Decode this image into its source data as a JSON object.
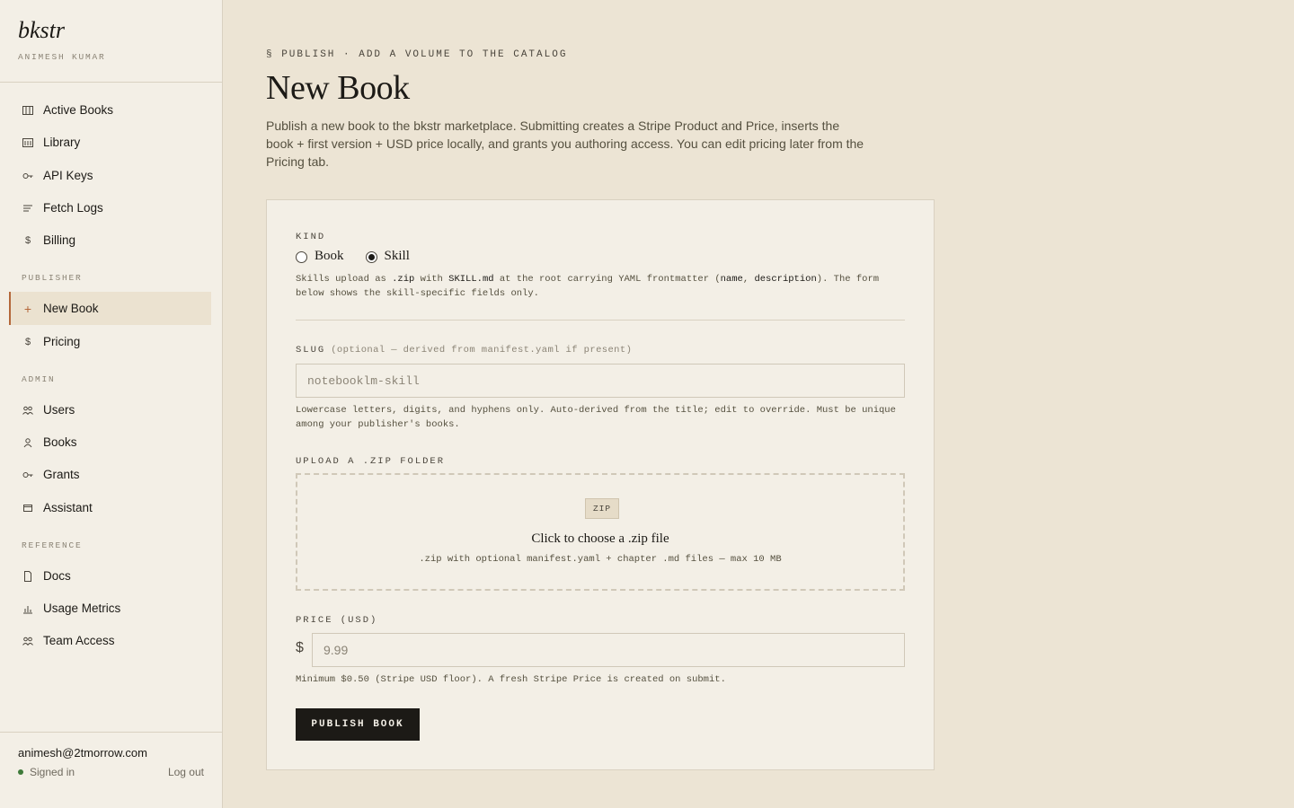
{
  "brand": {
    "name": "bkstr",
    "user": "ANIMESH KUMAR"
  },
  "nav": {
    "main": [
      {
        "label": "Active Books",
        "icon": "columns-icon"
      },
      {
        "label": "Library",
        "icon": "library-icon"
      },
      {
        "label": "API Keys",
        "icon": "key-icon"
      },
      {
        "label": "Fetch Logs",
        "icon": "lines-icon"
      },
      {
        "label": "Billing",
        "icon": "dollar-icon"
      }
    ],
    "publisher_label": "PUBLISHER",
    "publisher": [
      {
        "label": "New Book",
        "icon": "plus-icon",
        "active": true
      },
      {
        "label": "Pricing",
        "icon": "dollar-icon"
      }
    ],
    "admin_label": "ADMIN",
    "admin": [
      {
        "label": "Users",
        "icon": "users-icon"
      },
      {
        "label": "Books",
        "icon": "person-icon"
      },
      {
        "label": "Grants",
        "icon": "key-icon"
      },
      {
        "label": "Assistant",
        "icon": "window-icon"
      }
    ],
    "reference_label": "REFERENCE",
    "reference": [
      {
        "label": "Docs",
        "icon": "document-icon"
      },
      {
        "label": "Usage Metrics",
        "icon": "bar-chart-icon"
      },
      {
        "label": "Team Access",
        "icon": "users-icon"
      }
    ]
  },
  "footer": {
    "email": "animesh@2tmorrow.com",
    "status": "Signed in",
    "logout": "Log out",
    "status_color": "#3e7a3a"
  },
  "page": {
    "eyebrow": "§ PUBLISH · ADD A VOLUME TO THE CATALOG",
    "title": "New Book",
    "lede": "Publish a new book to the bkstr marketplace. Submitting creates a Stripe Product and Price, inserts the book + first version + USD price locally, and grants you authoring access. You can edit pricing later from the Pricing tab."
  },
  "form": {
    "kind_label": "KIND",
    "kind_options": [
      "Book",
      "Skill"
    ],
    "kind_selected": "Skill",
    "kind_help": {
      "p1": "Skills upload as ",
      "c1": ".zip",
      "p2": " with ",
      "c2": "SKILL.md",
      "p3": " at the root carrying YAML frontmatter (",
      "c3": "name",
      "p4": ", ",
      "c4": "description",
      "p5": "). The form below shows the skill-specific fields only."
    },
    "slug_label": "SLUG",
    "slug_sub": "(optional — derived from manifest.yaml if present)",
    "slug_placeholder": "notebooklm-skill",
    "slug_help": "Lowercase letters, digits, and hyphens only. Auto-derived from the title; edit to override. Must be unique among your publisher's books.",
    "upload_label": "UPLOAD A .ZIP FOLDER",
    "upload_badge": "ZIP",
    "upload_title": "Click to choose a .zip file",
    "upload_sub": ".zip with optional manifest.yaml + chapter .md files — max 10 MB",
    "price_label": "PRICE (USD)",
    "price_symbol": "$",
    "price_placeholder": "9.99",
    "price_help": "Minimum $0.50 (Stripe USD floor). A fresh Stripe Price is created on submit.",
    "submit_label": "PUBLISH BOOK"
  },
  "colors": {
    "accent": "#b4673a",
    "background": "#ece4d4",
    "panel": "#f3efe6",
    "button": "#1c1a16"
  }
}
